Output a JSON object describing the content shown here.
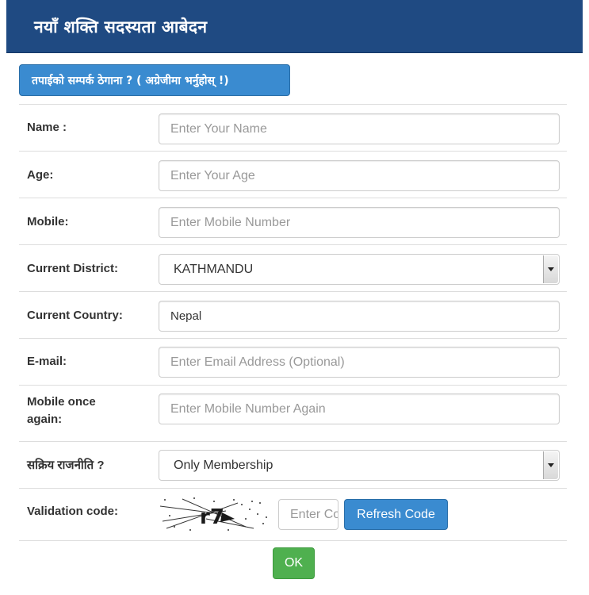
{
  "header": {
    "title": "नयाँ शक्ति सदस्यता आबेदन"
  },
  "language_button": {
    "label": "तपाईको सम्पर्क ठेगाना ?    ( अग्रेजीमा भर्नुहोस् !)"
  },
  "fields": {
    "name": {
      "label": "Name :",
      "placeholder": "Enter Your Name"
    },
    "age": {
      "label": "Age:",
      "placeholder": "Enter Your Age"
    },
    "mobile": {
      "label": "Mobile:",
      "placeholder": "Enter Mobile Number"
    },
    "district": {
      "label": "Current District:",
      "selected": "KATHMANDU"
    },
    "country": {
      "label": "Current Country:",
      "value": "Nepal"
    },
    "email": {
      "label": "E-mail:",
      "placeholder": "Enter Email Address (Optional)"
    },
    "mobile_again": {
      "label_line1": "Mobile once",
      "label_line2": "again:",
      "placeholder": "Enter Mobile Number Again"
    },
    "politics": {
      "label": "सक्रिय राजनीति ?",
      "selected": "Only Membership"
    },
    "validation": {
      "label": "Validation code:",
      "captcha_text": "r7",
      "input_placeholder": "Enter Code",
      "refresh_label": "Refresh Code"
    }
  },
  "submit": {
    "label": "OK"
  }
}
